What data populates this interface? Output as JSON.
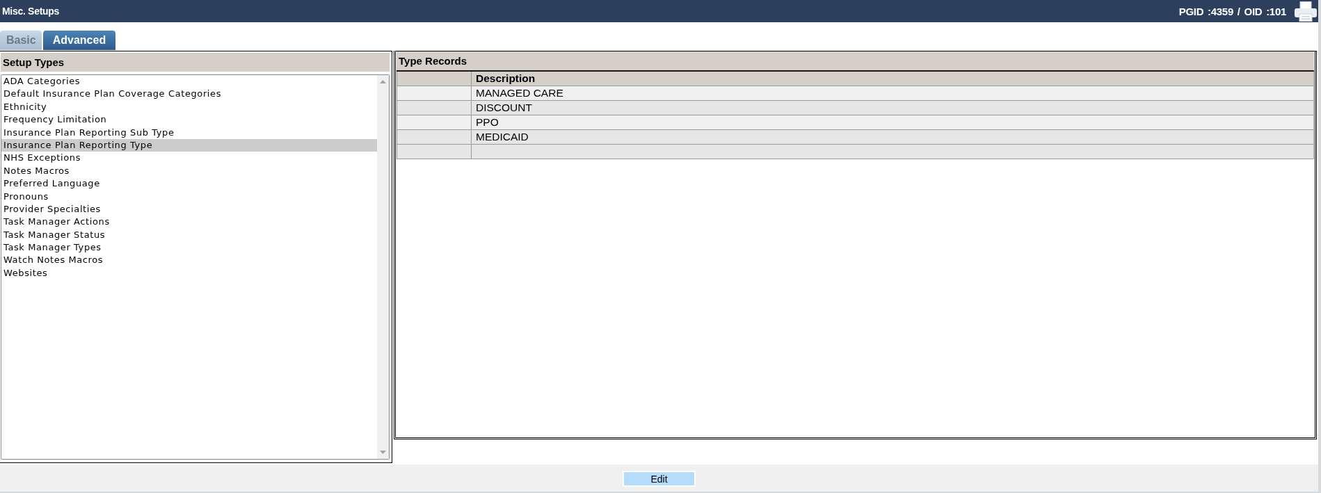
{
  "header": {
    "title": "Misc. Setups",
    "ids": "PGID :4359 / OID :101"
  },
  "tabs": [
    {
      "label": "Basic",
      "selected": false
    },
    {
      "label": "Advanced",
      "selected": true
    }
  ],
  "setup_types": {
    "title": "Setup Types",
    "items": [
      {
        "label": "ADA Categories",
        "selected": false
      },
      {
        "label": "Default Insurance Plan Coverage Categories",
        "selected": false
      },
      {
        "label": "Ethnicity",
        "selected": false
      },
      {
        "label": "Frequency Limitation",
        "selected": false
      },
      {
        "label": "Insurance Plan Reporting Sub Type",
        "selected": false
      },
      {
        "label": "Insurance Plan Reporting Type",
        "selected": true
      },
      {
        "label": "NHS Exceptions",
        "selected": false
      },
      {
        "label": "Notes Macros",
        "selected": false
      },
      {
        "label": "Preferred Language",
        "selected": false
      },
      {
        "label": "Pronouns",
        "selected": false
      },
      {
        "label": "Provider Specialties",
        "selected": false
      },
      {
        "label": "Task Manager Actions",
        "selected": false
      },
      {
        "label": "Task Manager Status",
        "selected": false
      },
      {
        "label": "Task Manager Types",
        "selected": false
      },
      {
        "label": "Watch Notes Macros",
        "selected": false
      },
      {
        "label": "Websites",
        "selected": false
      }
    ]
  },
  "type_records": {
    "title": "Type Records",
    "header": "Description",
    "rows": [
      {
        "kind": "record",
        "description": "MANAGED CARE"
      },
      {
        "kind": "record",
        "description": "DISCOUNT"
      },
      {
        "kind": "record",
        "description": "PPO"
      },
      {
        "kind": "record",
        "description": "MEDICAID"
      },
      {
        "kind": "blank"
      }
    ]
  },
  "footer": {
    "buttons": [
      {
        "label": "Edit"
      }
    ]
  }
}
